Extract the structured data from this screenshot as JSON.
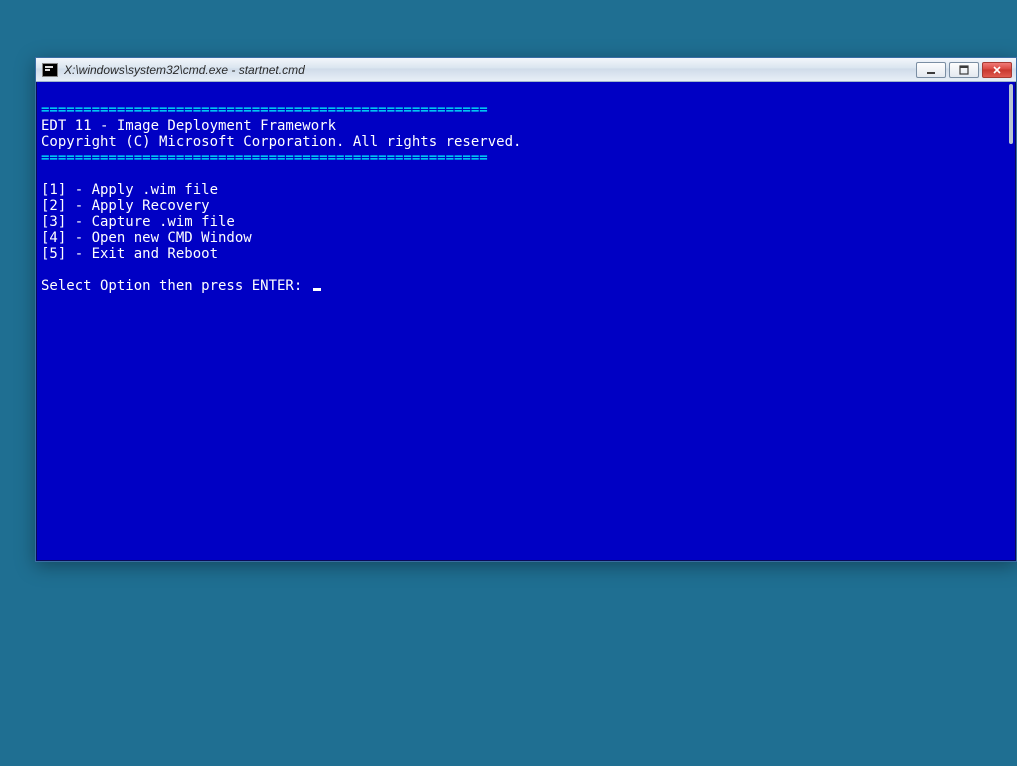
{
  "window": {
    "title": "X:\\windows\\system32\\cmd.exe - startnet.cmd"
  },
  "console": {
    "separator": "=====================================================",
    "header_product": "EDT 11 - Image Deployment Framework",
    "header_copyright": "Copyright (C) Microsoft Corporation. All rights reserved.",
    "options": [
      "[1] - Apply .wim file",
      "[2] - Apply Recovery",
      "[3] - Capture .wim file",
      "[4] - Open new CMD Window",
      "[5] - Exit and Reboot"
    ],
    "prompt": "Select Option then press ENTER: "
  }
}
